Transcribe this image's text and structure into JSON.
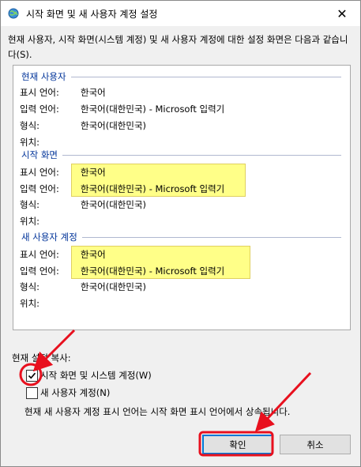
{
  "window": {
    "title": "시작 화면 및 새 사용자 계정 설정",
    "close_glyph": "✕"
  },
  "description": "현재 사용자, 시작 화면(시스템 계정) 및 새 사용자 계정에 대한 설정 화면은 다음과 같습니다(S).",
  "sections": [
    {
      "title": "현재 사용자",
      "rows": [
        {
          "label": "표시 언어:",
          "value": "한국어"
        },
        {
          "label": "입력 언어:",
          "value": "한국어(대한민국) - Microsoft 입력기"
        },
        {
          "label": "형식:",
          "value": "한국어(대한민국)"
        },
        {
          "label": "위치:",
          "value": ""
        }
      ]
    },
    {
      "title": "시작 화면",
      "rows": [
        {
          "label": "표시 언어:",
          "value": "한국어"
        },
        {
          "label": "입력 언어:",
          "value": "한국어(대한민국) - Microsoft 입력기"
        },
        {
          "label": "형식:",
          "value": "한국어(대한민국)"
        },
        {
          "label": "위치:",
          "value": ""
        }
      ]
    },
    {
      "title": "새 사용자 계정",
      "rows": [
        {
          "label": "표시 언어:",
          "value": "한국어"
        },
        {
          "label": "입력 언어:",
          "value": "한국어(대한민국) - Microsoft 입력기"
        },
        {
          "label": "형식:",
          "value": "한국어(대한민국)"
        },
        {
          "label": "위치:",
          "value": ""
        }
      ]
    }
  ],
  "copy_settings": {
    "label": "현재 설정 복사:",
    "options": [
      {
        "label": "시작 화면 및 시스템 계정(W)",
        "checked": true
      },
      {
        "label": "새 사용자 계정(N)",
        "checked": false
      }
    ],
    "note": "현재 새 사용자 계정 표시 언어는 시작 화면 표시 언어에서 상속됩니다."
  },
  "buttons": {
    "ok": "확인",
    "cancel": "취소"
  },
  "colors": {
    "highlight": "#ffff88",
    "annotation": "#e8101e",
    "section_title": "#003399",
    "default_button_border": "#0078d7"
  }
}
